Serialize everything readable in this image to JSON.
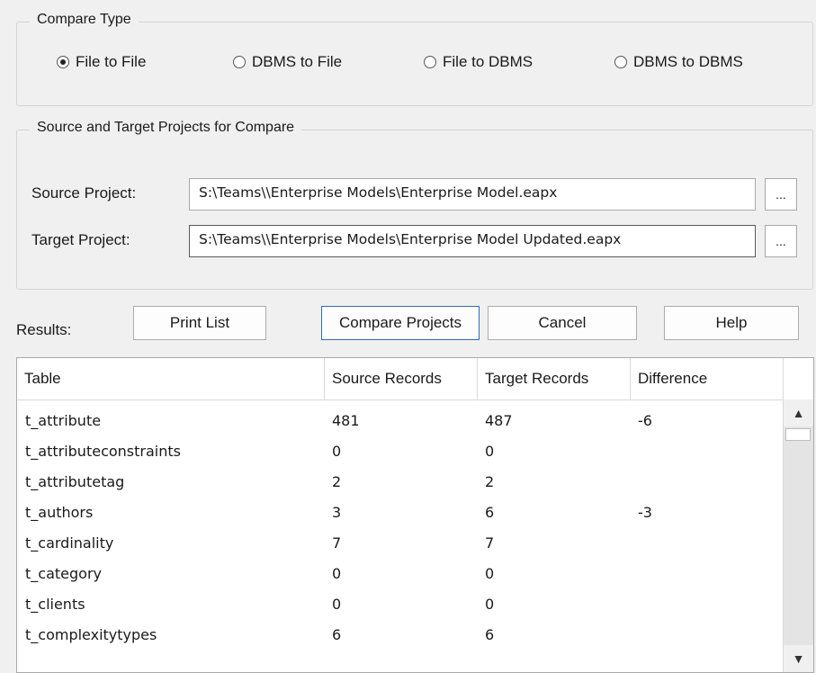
{
  "compare_type": {
    "legend": "Compare Type",
    "options": [
      {
        "label": "File to File",
        "selected": true
      },
      {
        "label": "DBMS to File",
        "selected": false
      },
      {
        "label": "File to DBMS",
        "selected": false
      },
      {
        "label": "DBMS to DBMS",
        "selected": false
      }
    ]
  },
  "projects": {
    "legend": "Source and Target Projects for Compare",
    "source_label": "Source Project:",
    "source_value": "S:\\Teams\\\\Enterprise Models\\Enterprise Model.eapx",
    "target_label": "Target Project:",
    "target_value": "S:\\Teams\\\\Enterprise Models\\Enterprise Model Updated.eapx",
    "browse_label": "..."
  },
  "actions": {
    "results_label": "Results:",
    "print_list": "Print List",
    "compare_projects": "Compare Projects",
    "cancel": "Cancel",
    "help": "Help"
  },
  "table": {
    "headers": [
      "Table",
      "Source Records",
      "Target Records",
      "Difference"
    ],
    "rows": [
      [
        "t_attribute",
        "481",
        "487",
        "-6"
      ],
      [
        "t_attributeconstraints",
        "0",
        "0",
        ""
      ],
      [
        "t_attributetag",
        "2",
        "2",
        ""
      ],
      [
        "t_authors",
        "3",
        "6",
        "-3"
      ],
      [
        "t_cardinality",
        "7",
        "7",
        ""
      ],
      [
        "t_category",
        "0",
        "0",
        ""
      ],
      [
        "t_clients",
        "0",
        "0",
        ""
      ],
      [
        "t_complexitytypes",
        "6",
        "6",
        ""
      ]
    ]
  }
}
